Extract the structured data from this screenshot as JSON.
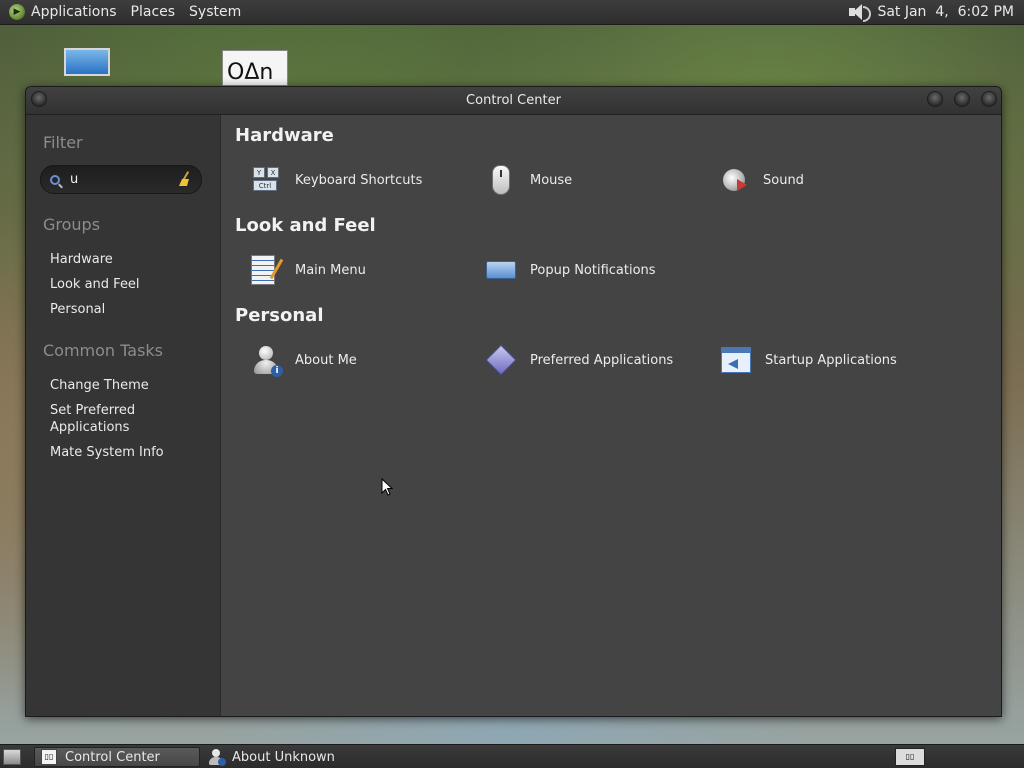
{
  "top_panel": {
    "menus": [
      "Applications",
      "Places",
      "System"
    ],
    "clock": "Sat Jan  4,  6:02 PM",
    "icons": {
      "menu_logo": "mate-logo-icon",
      "volume": "volume-icon"
    }
  },
  "desktop": {
    "icons": [
      "computer-icon",
      "document-icon"
    ],
    "doc_glyphs": "OΔn"
  },
  "window": {
    "title": "Control Center"
  },
  "sidebar": {
    "filter_heading": "Filter",
    "search_value": "u",
    "groups_heading": "Groups",
    "groups": [
      "Hardware",
      "Look and Feel",
      "Personal"
    ],
    "tasks_heading": "Common Tasks",
    "tasks": [
      "Change Theme",
      "Set Preferred Applications",
      "Mate System Info"
    ]
  },
  "content": {
    "sections": [
      {
        "title": "Hardware",
        "items": [
          {
            "label": "Keyboard Shortcuts",
            "icon": "keyboard-icon"
          },
          {
            "label": "Mouse",
            "icon": "mouse-icon"
          },
          {
            "label": "Sound",
            "icon": "sound-icon"
          }
        ]
      },
      {
        "title": "Look and Feel",
        "items": [
          {
            "label": "Main Menu",
            "icon": "main-menu-icon"
          },
          {
            "label": "Popup Notifications",
            "icon": "popup-notifications-icon"
          }
        ]
      },
      {
        "title": "Personal",
        "items": [
          {
            "label": "About Me",
            "icon": "about-me-icon"
          },
          {
            "label": "Preferred Applications",
            "icon": "preferred-applications-icon"
          },
          {
            "label": "Startup Applications",
            "icon": "startup-applications-icon"
          }
        ]
      }
    ],
    "keyboard_keys": [
      "Y",
      "X",
      "Ctrl"
    ]
  },
  "taskbar": {
    "tasks": [
      {
        "label": "Control Center",
        "active": true
      },
      {
        "label": "About Unknown",
        "active": false
      }
    ],
    "workspace_label": "▯▯"
  }
}
